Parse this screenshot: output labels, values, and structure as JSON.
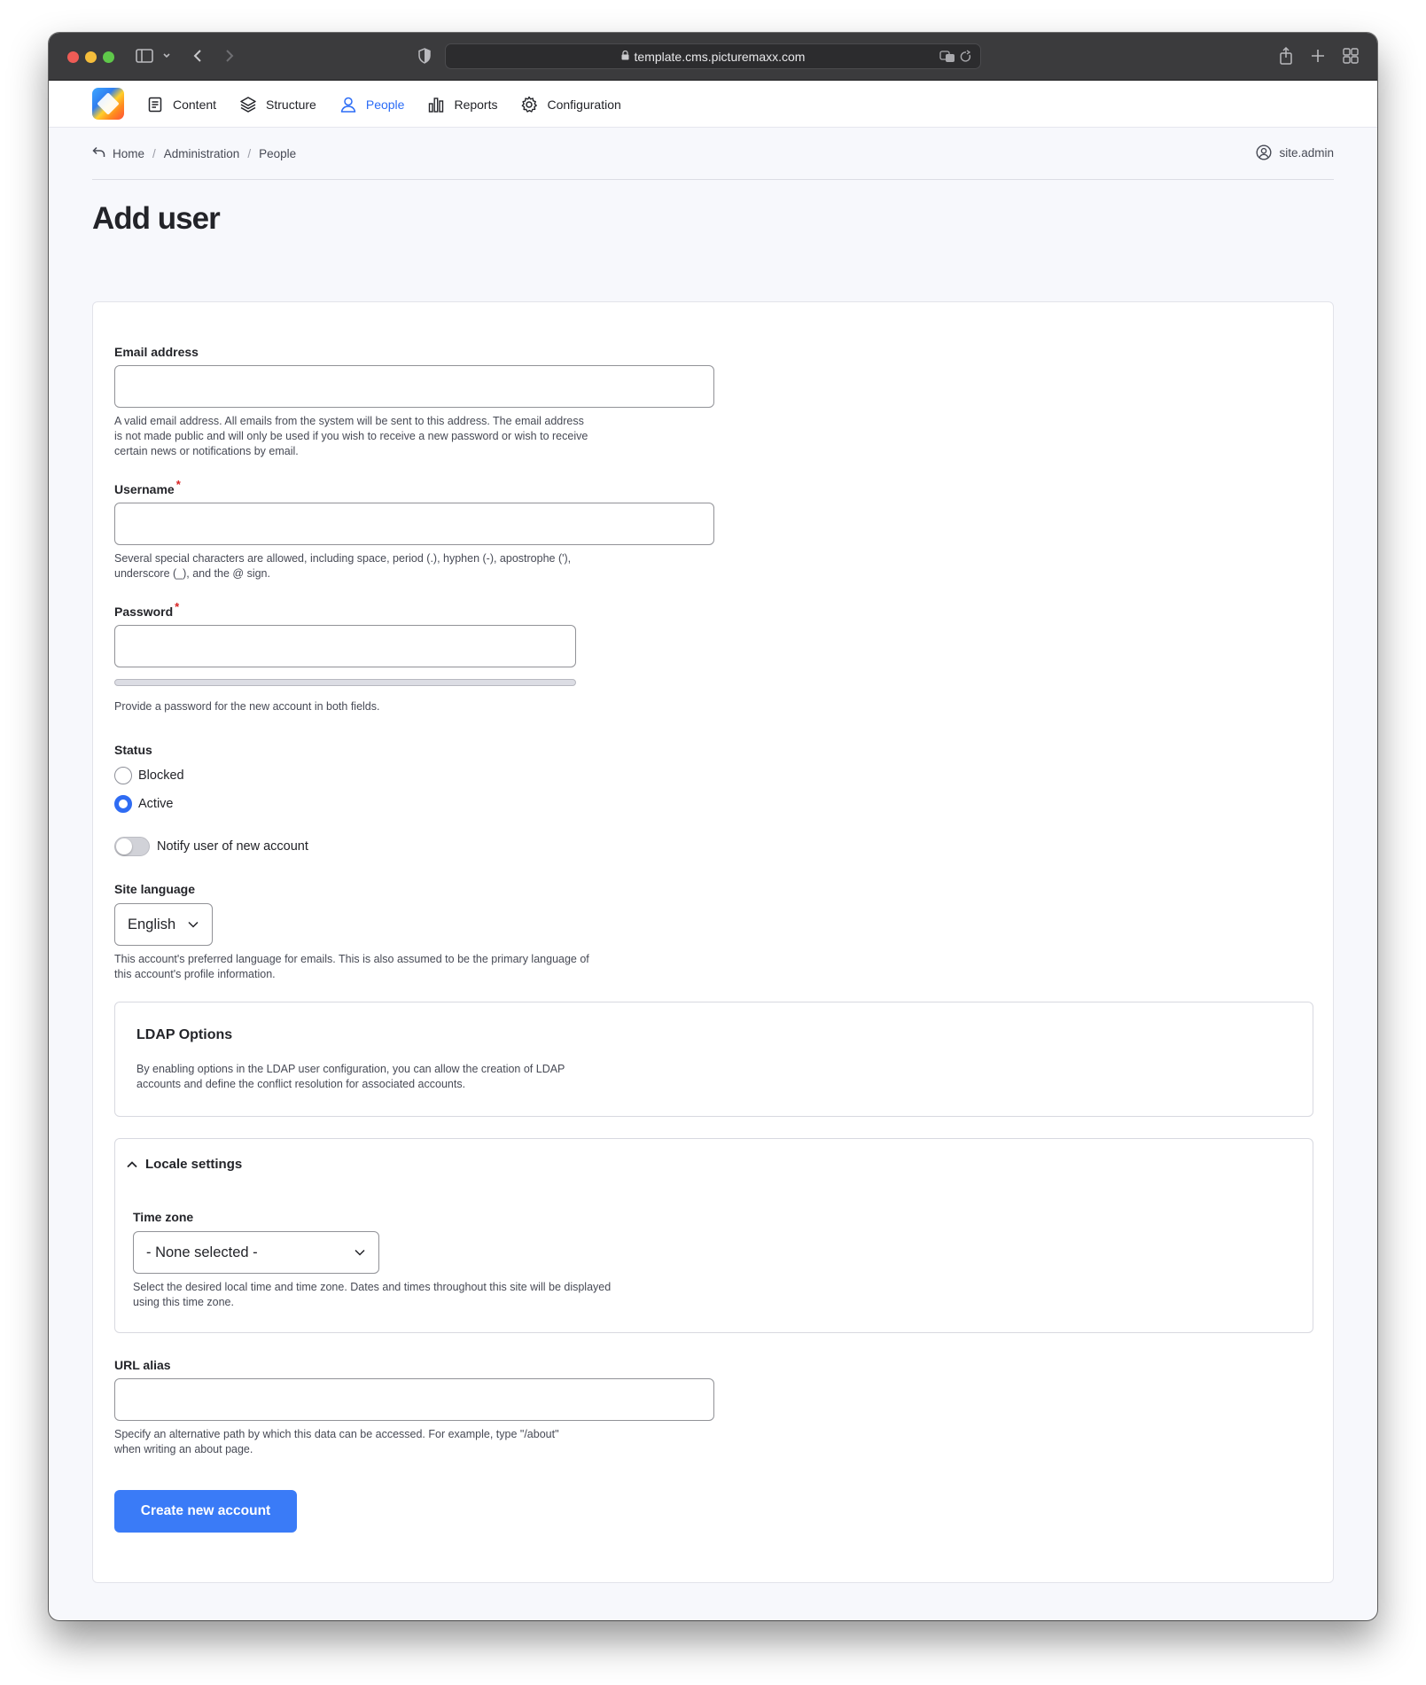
{
  "browser": {
    "url": "template.cms.picturemaxx.com"
  },
  "toolbar": {
    "items": [
      {
        "label": "Content",
        "icon": "document-icon"
      },
      {
        "label": "Structure",
        "icon": "layers-icon"
      },
      {
        "label": "People",
        "icon": "person-icon"
      },
      {
        "label": "Reports",
        "icon": "bar-chart-icon"
      },
      {
        "label": "Configuration",
        "icon": "gear-icon"
      }
    ]
  },
  "breadcrumb": {
    "items": [
      "Home",
      "Administration",
      "People"
    ]
  },
  "user": {
    "name": "site.admin"
  },
  "page": {
    "title": "Add user"
  },
  "form": {
    "email": {
      "label": "Email address",
      "value": "",
      "description": "A valid email address. All emails from the system will be sent to this address. The email address is not made public and will only be used if you wish to receive a new password or wish to receive certain news or notifications by email."
    },
    "username": {
      "label": "Username",
      "required_mark": "*",
      "value": "",
      "description": "Several special characters are allowed, including space, period (.), hyphen (-), apostrophe ('), underscore (_), and the @ sign."
    },
    "password": {
      "label": "Password",
      "required_mark": "*",
      "value": "",
      "description": "Provide a password for the new account in both fields."
    },
    "status": {
      "label": "Status",
      "options": [
        "Blocked",
        "Active"
      ],
      "selected": "Active"
    },
    "notify": {
      "label": "Notify user of new account",
      "on": false
    },
    "site_language": {
      "label": "Site language",
      "value": "English",
      "description": "This account's preferred language for emails. This is also assumed to be the primary language of this account's profile information."
    },
    "ldap": {
      "title": "LDAP Options",
      "description": "By enabling options in the LDAP user configuration, you can allow the creation of LDAP accounts and define the conflict resolution for associated accounts."
    },
    "locale": {
      "title": "Locale settings",
      "timezone": {
        "label": "Time zone",
        "value": "- None selected -",
        "description": "Select the desired local time and time zone. Dates and times throughout this site will be displayed using this time zone."
      }
    },
    "url_alias": {
      "label": "URL alias",
      "value": "",
      "description": "Specify an alternative path by which this data can be accessed. For example, type \"/about\" when writing an about page."
    },
    "submit_label": "Create new account"
  },
  "colors": {
    "accent": "#3a7bf7",
    "active_nav": "#2b6cf6",
    "required": "#d72222"
  }
}
